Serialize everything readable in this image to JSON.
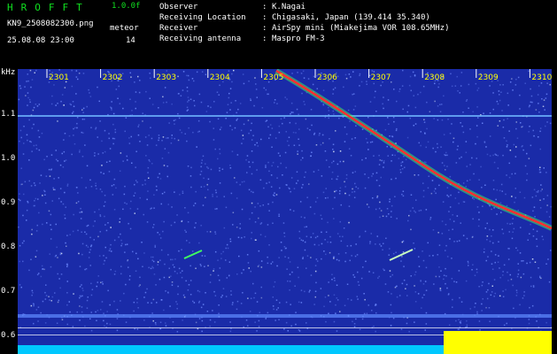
{
  "header": {
    "app_title": "HROFFT",
    "version": "1.0.0f",
    "file_name": "KN9_2508082300.png",
    "meteor_label": "meteor",
    "date_time": "25.08.08 23:00",
    "meteor_count": "14",
    "info": [
      {
        "key": "Observer",
        "value": "K.Nagai"
      },
      {
        "key": "Receiving Location",
        "value": "Chigasaki, Japan (139.414 35.340)"
      },
      {
        "key": "Receiver",
        "value": "AirSpy mini (Miakejima VOR 108.65MHz)"
      },
      {
        "key": "Receiving antenna",
        "value": "Maspro FM-3"
      }
    ]
  },
  "spectrogram": {
    "y_unit": "kHz",
    "y_ticks": [
      "1.1",
      "1.0",
      "0.9",
      "0.8",
      "0.7",
      "0.6"
    ],
    "x_ticks": [
      "2301",
      "2302",
      "2303",
      "2304",
      "2305",
      "2306",
      "2307",
      "2308",
      "2309",
      "2310"
    ],
    "colors": {
      "background": "#1a2ba8",
      "noise": "#6f8bff",
      "bright": "#e8f4ff",
      "trace_core": "#ff3030",
      "trace_edge": "#40ff60",
      "bottom_band": "#00c8ff",
      "saturation": "#ffff00",
      "tick_label": "#ffff00",
      "axis_text": "#ffffff"
    }
  }
}
